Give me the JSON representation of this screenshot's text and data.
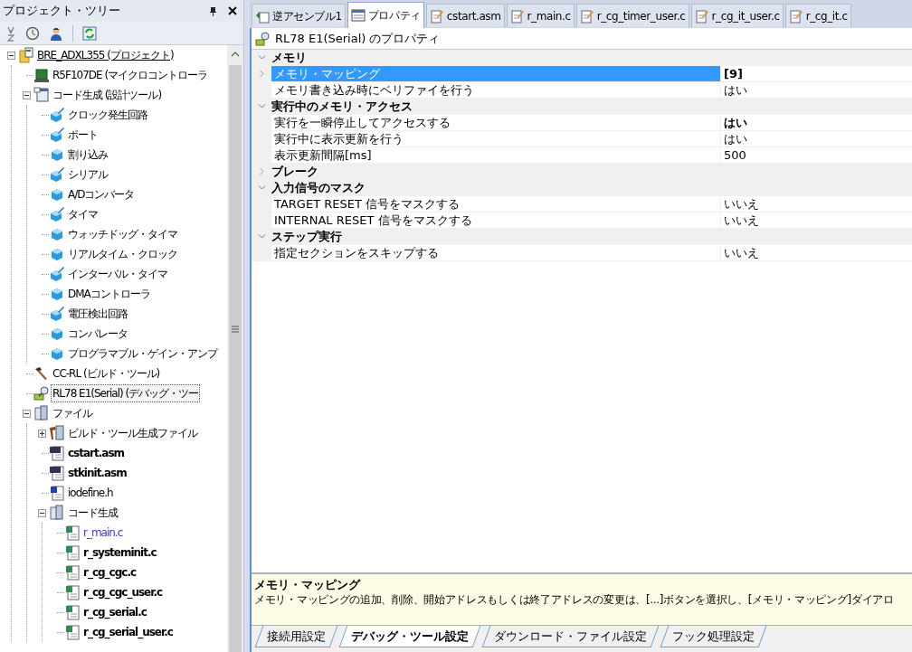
{
  "project_tree": {
    "title": "プロジェクト・ツリー",
    "items": [
      {
        "label": "BRE_ADXL355 (プロジェクト)",
        "kind": "project",
        "active": true,
        "expanded": true,
        "children": [
          {
            "label": "R5F107DE (マイクロコントローラ",
            "kind": "chip"
          },
          {
            "label": "コード生成 (設計ツール)",
            "kind": "codegen",
            "expanded": true,
            "children": [
              {
                "label": "クロック発生回路",
                "kind": "module-edit"
              },
              {
                "label": "ポート",
                "kind": "module-edit"
              },
              {
                "label": "割り込み",
                "kind": "module"
              },
              {
                "label": "シリアル",
                "kind": "module-edit"
              },
              {
                "label": "A/Dコンバータ",
                "kind": "module"
              },
              {
                "label": "タイマ",
                "kind": "module-edit"
              },
              {
                "label": "ウォッチドッグ・タイマ",
                "kind": "module"
              },
              {
                "label": "リアルタイム・クロック",
                "kind": "module"
              },
              {
                "label": "インターバル・タイマ",
                "kind": "module-edit"
              },
              {
                "label": "DMAコントローラ",
                "kind": "module"
              },
              {
                "label": "電圧検出回路",
                "kind": "module-edit"
              },
              {
                "label": "コンパレータ",
                "kind": "module"
              },
              {
                "label": "プログラマブル・ゲイン・アンプ",
                "kind": "module"
              }
            ]
          },
          {
            "label": "CC-RL (ビルド・ツール)",
            "kind": "hammer"
          },
          {
            "label": "RL78 E1(Serial) (デバッグ・ツー",
            "kind": "debug",
            "focused": true
          },
          {
            "label": "ファイル",
            "kind": "folder",
            "expanded": true,
            "children": [
              {
                "label": "ビルド・ツール生成ファイル",
                "kind": "build-folder",
                "expanded": false
              },
              {
                "label": "cstart.asm",
                "kind": "asm",
                "bold": true
              },
              {
                "label": "stkinit.asm",
                "kind": "asm",
                "bold": true
              },
              {
                "label": "iodefine.h",
                "kind": "h"
              },
              {
                "label": "コード生成",
                "kind": "folder",
                "expanded": true,
                "children": [
                  {
                    "label": "r_main.c",
                    "kind": "c",
                    "color": "#3a3ad0"
                  },
                  {
                    "label": "r_systeminit.c",
                    "kind": "c",
                    "bold": true
                  },
                  {
                    "label": "r_cg_cgc.c",
                    "kind": "c",
                    "bold": true
                  },
                  {
                    "label": "r_cg_cgc_user.c",
                    "kind": "c",
                    "bold": true
                  },
                  {
                    "label": "r_cg_serial.c",
                    "kind": "c",
                    "bold": true
                  },
                  {
                    "label": "r_cg_serial_user.c",
                    "kind": "c",
                    "bold": true
                  }
                ]
              }
            ]
          }
        ]
      }
    ]
  },
  "editor_tabs": [
    {
      "label": "逆アセンブル1",
      "kind": "disasm",
      "selected": false
    },
    {
      "label": "プロパティ",
      "kind": "property",
      "selected": true
    },
    {
      "label": "cstart.asm",
      "kind": "file",
      "selected": false
    },
    {
      "label": "r_main.c",
      "kind": "file",
      "selected": false
    },
    {
      "label": "r_cg_timer_user.c",
      "kind": "file",
      "selected": false
    },
    {
      "label": "r_cg_it_user.c",
      "kind": "file",
      "selected": false
    },
    {
      "label": "r_cg_it.c",
      "kind": "file",
      "selected": false
    }
  ],
  "property_panel": {
    "title": "RL78 E1(Serial) のプロパティ",
    "categories": [
      {
        "label": "メモリ",
        "expanded": true,
        "properties": [
          {
            "name": "メモリ・マッピング",
            "value": "[9]",
            "bold": true,
            "selected": true,
            "expandable": true
          },
          {
            "name": "メモリ書き込み時にベリファイを行う",
            "value": "はい",
            "bold": false,
            "selected": false
          }
        ]
      },
      {
        "label": "実行中のメモリ・アクセス",
        "expanded": true,
        "properties": [
          {
            "name": "実行を一瞬停止してアクセスする",
            "value": "はい",
            "bold": true,
            "selected": false
          },
          {
            "name": "実行中に表示更新を行う",
            "value": "はい",
            "bold": false,
            "selected": false
          },
          {
            "name": "表示更新間隔[ms]",
            "value": "500",
            "bold": false,
            "selected": false
          }
        ]
      },
      {
        "label": "ブレーク",
        "expanded": false
      },
      {
        "label": "入力信号のマスク",
        "expanded": true,
        "properties": [
          {
            "name": "TARGET  RESET 信号をマスクする",
            "value": "いいえ",
            "bold": false,
            "selected": false
          },
          {
            "name": "INTERNAL  RESET 信号をマスクする",
            "value": "いいえ",
            "bold": false,
            "selected": false
          }
        ]
      },
      {
        "label": "ステップ実行",
        "expanded": true,
        "properties": [
          {
            "name": "指定セクションをスキップする",
            "value": "いいえ",
            "bold": false,
            "selected": false
          }
        ]
      }
    ]
  },
  "description": {
    "title": "メモリ・マッピング",
    "text": "メモリ・マッピングの追加、削除、開始アドレスもしくは終了アドレスの変更は、[...]ボタンを選択し、[メモリ・マッピング]ダイアロ"
  },
  "bottom_tabs": [
    {
      "label": "接続用設定",
      "selected": false
    },
    {
      "label": "デバッグ・ツール設定",
      "selected": true
    },
    {
      "label": "ダウンロード・ファイル設定",
      "selected": false
    },
    {
      "label": "フック処理設定",
      "selected": false
    }
  ]
}
